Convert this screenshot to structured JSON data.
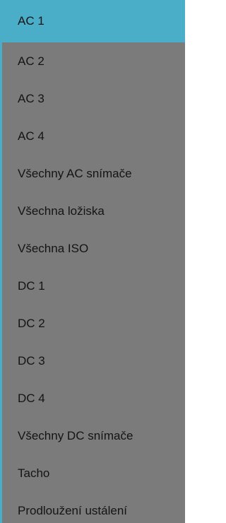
{
  "menu": {
    "selected_index": 0,
    "items": [
      {
        "label": "AC 1"
      },
      {
        "label": "AC 2"
      },
      {
        "label": "AC 3"
      },
      {
        "label": "AC 4"
      },
      {
        "label": "Všechny AC snímače"
      },
      {
        "label": "Všechna ložiska"
      },
      {
        "label": "Všechna ISO"
      },
      {
        "label": "DC 1"
      },
      {
        "label": "DC 2"
      },
      {
        "label": "DC 3"
      },
      {
        "label": "DC 4"
      },
      {
        "label": "Všechny DC snímače"
      },
      {
        "label": "Tacho"
      },
      {
        "label": "Prodloužení ustálení"
      }
    ],
    "colors": {
      "background": "#7b7b7b",
      "selected": "#4aaec8",
      "text": "#141414"
    }
  }
}
